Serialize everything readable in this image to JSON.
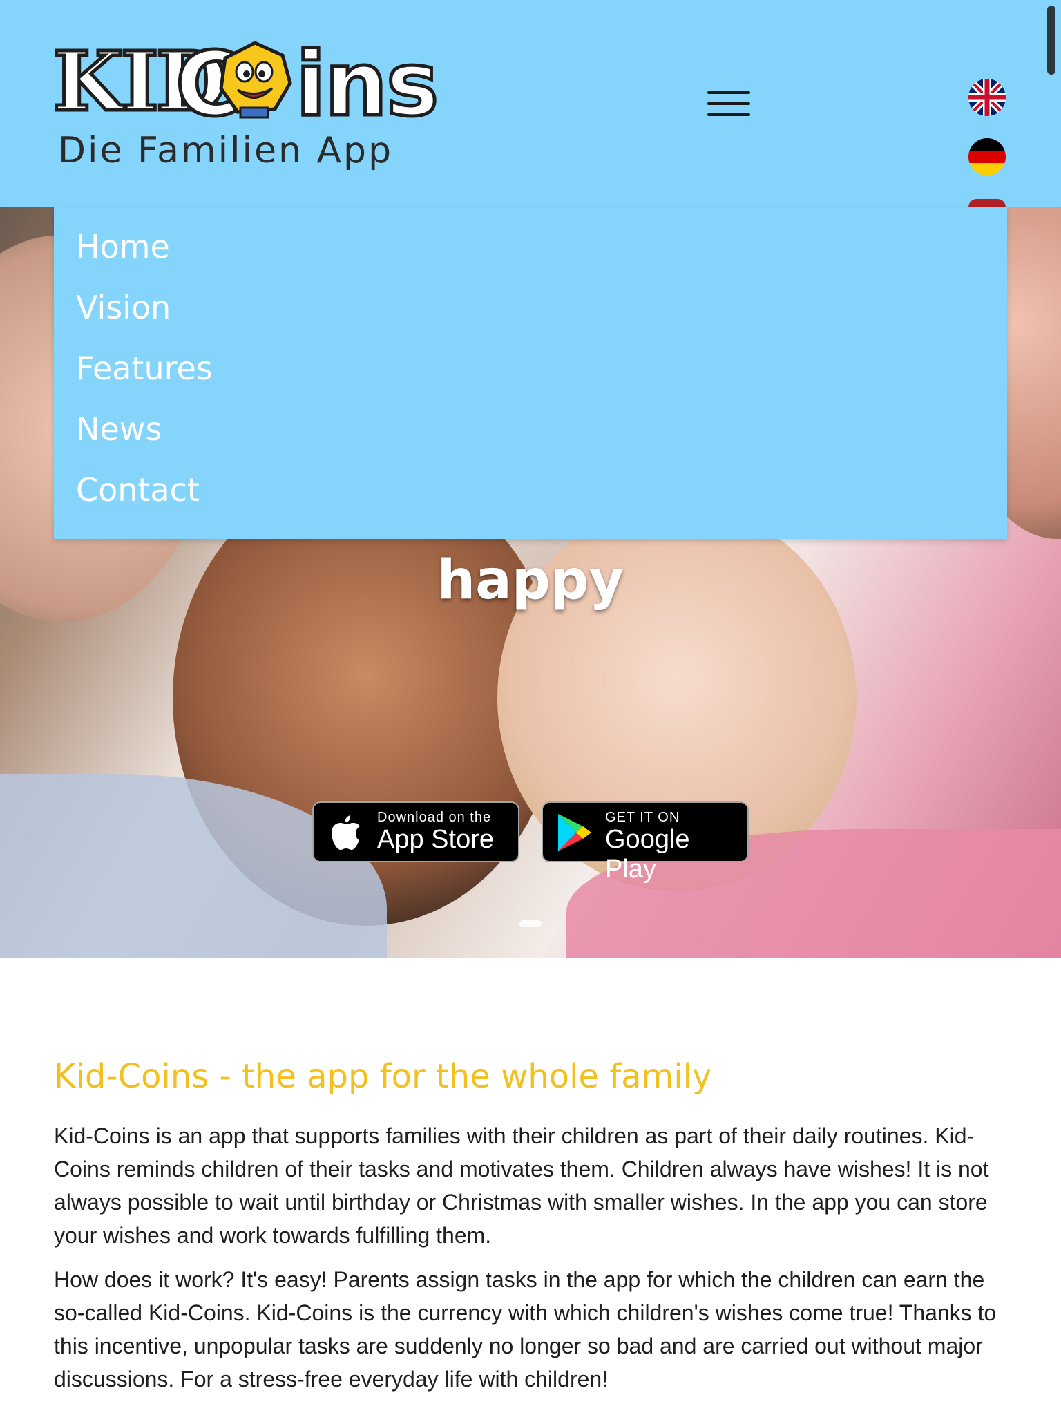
{
  "brand": {
    "logo_kid": "KID",
    "logo_c": "C",
    "logo_ins": "ins",
    "tagline": "Die Familien App"
  },
  "header": {
    "menu_icon": "hamburger-icon",
    "languages": [
      "english-flag-icon",
      "german-flag-icon",
      "language-flag-icon"
    ]
  },
  "menu": {
    "items": [
      "Home",
      "Vision",
      "Features",
      "News",
      "Contact"
    ]
  },
  "hero": {
    "word": "happy",
    "app_store": {
      "small": "Download on the",
      "big": "App Store",
      "icon": "apple-icon"
    },
    "google_play": {
      "small": "GET IT ON",
      "big": "Google Play",
      "icon": "google-play-icon"
    }
  },
  "content": {
    "title": "Kid-Coins - the app for the whole family",
    "paragraph1": "Kid-Coins is an app that supports families with their children as part of their daily routines. Kid-Coins reminds children of their tasks and motivates them. Children always have wishes! It is not always possible to wait until birthday or Christmas with smaller wishes. In the app you can store your wishes and work towards fulfilling them.",
    "paragraph2": "How does it work? It's easy! Parents assign tasks in the app for which the children can earn the so-called Kid-Coins. Kid-Coins is the currency with which children's wishes come true! Thanks to this incentive, unpopular tasks are suddenly no longer so bad and are carried out without major discussions. For a stress-free everyday life with children!"
  },
  "colors": {
    "header_bg": "#84d4fb",
    "accent_yellow": "#f3c11f",
    "text": "#1f1f1f"
  }
}
